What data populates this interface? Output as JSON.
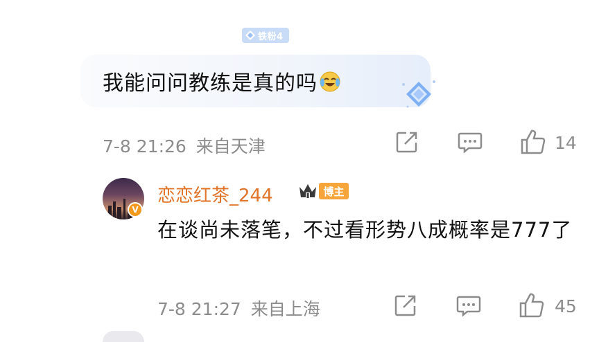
{
  "comment": {
    "badge_label": "铁粉4",
    "text": "我能问问教练是真的吗",
    "emoji_icon": "crying-laughing-emoji",
    "timestamp": "7-8 21:26",
    "location": "来自天津",
    "like_count": "14"
  },
  "reply": {
    "username": "恋恋红茶_244",
    "verified_mark": "V",
    "author_tag": "博主",
    "text": "在谈尚未落笔，不过看形势八成概率是777了",
    "timestamp": "7-8 21:27",
    "location": "来自上海",
    "like_count": "45"
  },
  "colors": {
    "username": "#e0752a",
    "author_tag_bg": "#f6a53a",
    "badge_bg": "#c9dcf7",
    "meta_text": "#8c8c8c"
  }
}
